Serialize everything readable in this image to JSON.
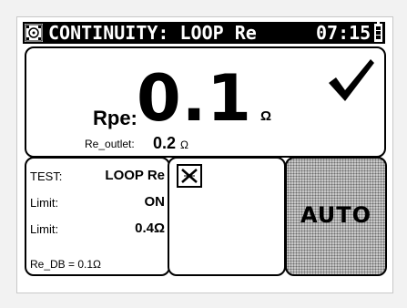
{
  "header": {
    "title": "CONTINUITY: LOOP Re",
    "time": "07:15",
    "app_icon": "meter-icon",
    "battery_icon": "battery-icon"
  },
  "result": {
    "label": "Rpe:",
    "value": "0.1",
    "unit": "Ω",
    "status_icon": "checkmark-icon",
    "outlet_label": "Re_outlet:",
    "outlet_value": "0.2",
    "outlet_unit": "Ω"
  },
  "info": {
    "test_label": "TEST:",
    "test_value": "LOOP Re",
    "limit1_label": "Limit:",
    "limit1_value": "ON",
    "limit2_label": "Limit:",
    "limit2_value": "0.4Ω",
    "db_text": "Re_DB = 0.1Ω"
  },
  "mid": {
    "icon": "cross-connection-icon"
  },
  "mode": {
    "label": "AUTO"
  }
}
